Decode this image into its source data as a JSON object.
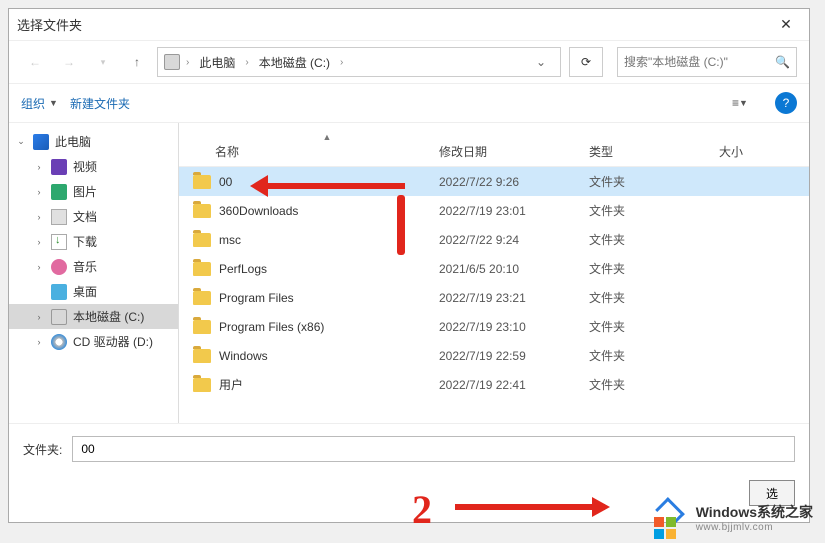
{
  "window": {
    "title": "选择文件夹"
  },
  "breadcrumb": {
    "pc": "此电脑",
    "drive": "本地磁盘 (C:)"
  },
  "search": {
    "placeholder": "搜索\"本地磁盘 (C:)\""
  },
  "toolbar": {
    "organize": "组织",
    "newfolder": "新建文件夹"
  },
  "columns": {
    "name": "名称",
    "date": "修改日期",
    "type": "类型",
    "size": "大小"
  },
  "tree": {
    "pc": "此电脑",
    "video": "视频",
    "pictures": "图片",
    "documents": "文档",
    "downloads": "下载",
    "music": "音乐",
    "desktop": "桌面",
    "drive_c": "本地磁盘 (C:)",
    "cd_d": "CD 驱动器 (D:)"
  },
  "files": [
    {
      "name": "00",
      "date": "2022/7/22 9:26",
      "type": "文件夹",
      "selected": true
    },
    {
      "name": "360Downloads",
      "date": "2022/7/19 23:01",
      "type": "文件夹",
      "selected": false
    },
    {
      "name": "msc",
      "date": "2022/7/22 9:24",
      "type": "文件夹",
      "selected": false
    },
    {
      "name": "PerfLogs",
      "date": "2021/6/5 20:10",
      "type": "文件夹",
      "selected": false
    },
    {
      "name": "Program Files",
      "date": "2022/7/19 23:21",
      "type": "文件夹",
      "selected": false
    },
    {
      "name": "Program Files (x86)",
      "date": "2022/7/19 23:10",
      "type": "文件夹",
      "selected": false
    },
    {
      "name": "Windows",
      "date": "2022/7/19 22:59",
      "type": "文件夹",
      "selected": false
    },
    {
      "name": "用户",
      "date": "2022/7/19 22:41",
      "type": "文件夹",
      "selected": false
    }
  ],
  "footer": {
    "label": "文件夹:",
    "value": "00",
    "select_btn": "选"
  },
  "annotation": {
    "step": "2"
  },
  "watermark": {
    "brand": "Windows系统之家",
    "url": "www.bjjmlv.com"
  }
}
